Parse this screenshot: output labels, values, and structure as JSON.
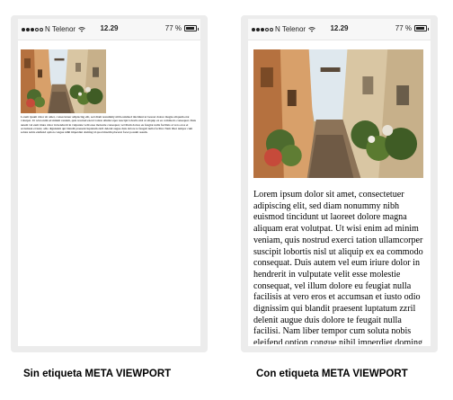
{
  "status_bar": {
    "carrier": "N Telenor",
    "time": "12.29",
    "battery": "77 %"
  },
  "article": {
    "image_alt": "street-photo",
    "body": "Lorem ipsum dolor sit amet, consectetuer adipiscing elit, sed diam nonummy nibh euismod tincidunt ut laoreet dolore magna aliquam erat volutpat. Ut wisi enim ad minim veniam, quis nostrud exerci tation ullamcorper suscipit lobortis nisl ut aliquip ex ea commodo consequat. Duis autem vel eum iriure dolor in hendrerit in vulputate velit esse molestie consequat, vel illum dolore eu feugiat nulla facilisis at vero eros et accumsan et iusto odio dignissim qui blandit praesent luptatum zzril delenit augue duis dolore te feugait nulla facilisi. Nam liber tempor cum soluta nobis eleifend option congue nihil imperdiet doming id quod mazim placerat facer possim assum."
  },
  "captions": {
    "left": "Sin etiqueta META VIEWPORT",
    "right": "Con etiqueta META VIEWPORT"
  }
}
